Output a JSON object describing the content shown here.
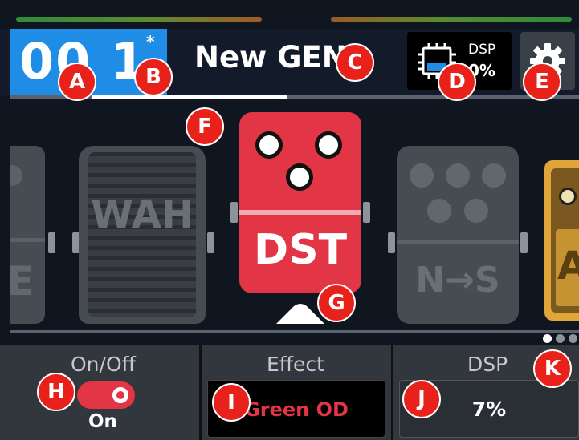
{
  "header": {
    "preset_number": "00 1",
    "modified_indicator": "*",
    "preset_name": "New GEN",
    "dsp_label": "DSP",
    "dsp_usage": "0%"
  },
  "chain": {
    "pedals": [
      {
        "name": "left-partial",
        "label": "E"
      },
      {
        "name": "wah",
        "label": "WAH"
      },
      {
        "name": "dst",
        "label": "DST"
      },
      {
        "name": "ns",
        "label": "N→S"
      },
      {
        "name": "right-partial",
        "label": "A"
      }
    ],
    "selected": "DST",
    "page": 1,
    "page_count": 3
  },
  "panels": {
    "onoff": {
      "title": "On/Off",
      "state": "On"
    },
    "effect": {
      "title": "Effect",
      "value": "Green OD"
    },
    "dsp": {
      "title": "DSP",
      "value": "7%"
    }
  },
  "markers": [
    "A",
    "B",
    "C",
    "D",
    "E",
    "F",
    "G",
    "H",
    "I",
    "J",
    "K"
  ],
  "colors": {
    "accent_blue": "#1f8ce6",
    "accent_red": "#e23545",
    "marker_red": "#e8211a",
    "background": "#0f1620"
  }
}
